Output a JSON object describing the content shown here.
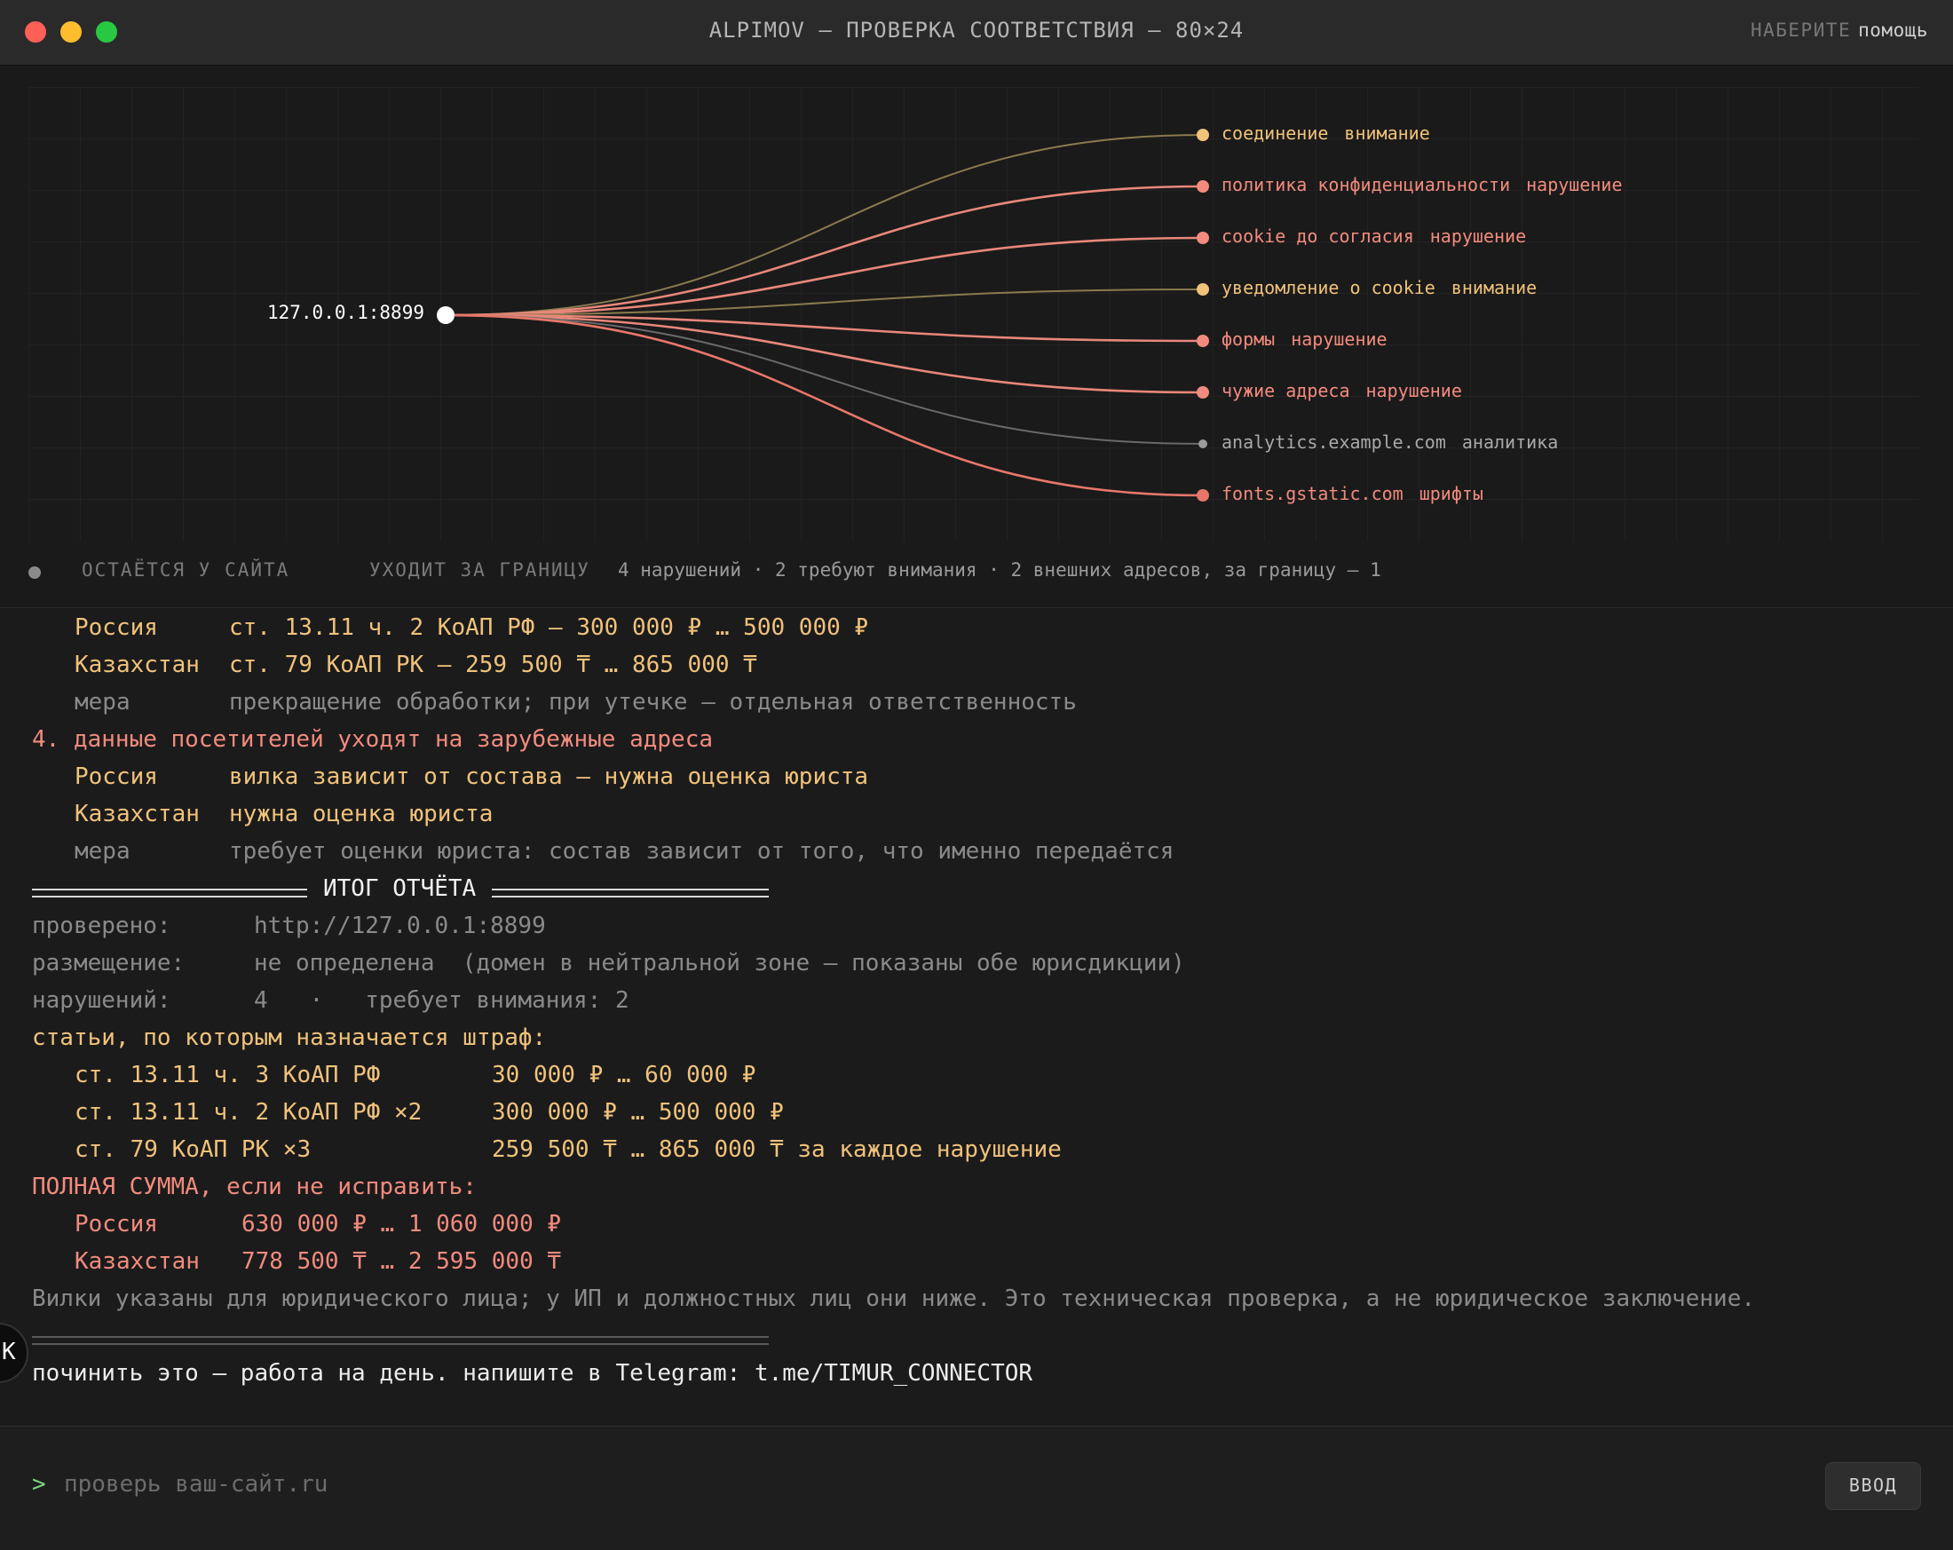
{
  "window": {
    "title": "ALPIMOV — ПРОВЕРКА СООТВЕТСТВИЯ — 80×24",
    "hint_prefix": "НАБЕРИТЕ",
    "hint_action": "помощь"
  },
  "graph": {
    "origin": "127.0.0.1:8899",
    "nodes": [
      {
        "name": "соединение",
        "status": "внимание",
        "level": "warn"
      },
      {
        "name": "политика конфиденциальности",
        "status": "нарушение",
        "level": "violation"
      },
      {
        "name": "cookie до согласия",
        "status": "нарушение",
        "level": "violation"
      },
      {
        "name": "уведомление о cookie",
        "status": "внимание",
        "level": "warn"
      },
      {
        "name": "формы",
        "status": "нарушение",
        "level": "violation"
      },
      {
        "name": "чужие адреса",
        "status": "нарушение",
        "level": "violation"
      },
      {
        "name": "analytics.example.com",
        "status": "аналитика",
        "level": "neutral"
      },
      {
        "name": "fonts.gstatic.com",
        "status": "шрифты",
        "level": "external"
      }
    ],
    "legend": {
      "stays": "ОСТАЁТСЯ У САЙТА",
      "leaves": "УХОДИТ ЗА ГРАНИЦУ",
      "summary": "4 нарушений · 2 требуют внимания · 2 внешних адресов, за границу — 1"
    },
    "colors": {
      "warn": "#f0c27a",
      "violation": "#f28b7d",
      "neutral": "#9a9a9a",
      "external": "#e8776a"
    }
  },
  "report": {
    "item3": {
      "russia_label": "Россия",
      "russia_value": "ст. 13.11 ч. 2 КоАП РФ — 300 000 ₽ … 500 000 ₽",
      "kz_label": "Казахстан",
      "kz_value": "ст. 79 КоАП РК — 259 500 ₸ … 865 000 ₸",
      "measure_label": "мера",
      "measure_value": "прекращение обработки; при утечке — отдельная ответственность"
    },
    "item4": {
      "title": "4. данные посетителей уходят на зарубежные адреса",
      "russia_label": "Россия",
      "russia_value": "вилка зависит от состава — нужна оценка юриста",
      "kz_label": "Казахстан",
      "kz_value": "нужна оценка юриста",
      "measure_label": "мера",
      "measure_value": "требует оценки юриста: состав зависит от того, что именно передаётся"
    },
    "summary_title": "ИТОГ ОТЧЁТА",
    "checked_label": "проверено:",
    "checked_value": "http://127.0.0.1:8899",
    "placement_label": "размещение:",
    "placement_value": "не определена  (домен в нейтральной зоне — показаны обе юрисдикции)",
    "violations_label": "нарушений:",
    "violations_value": "4   ·   требует внимания: 2",
    "articles_title": "статьи, по которым назначается штраф:",
    "articles": [
      {
        "name": "ст. 13.11 ч. 3 КоАП РФ",
        "value": "30 000 ₽ … 60 000 ₽"
      },
      {
        "name": "ст. 13.11 ч. 2 КоАП РФ ×2",
        "value": "300 000 ₽ … 500 000 ₽"
      },
      {
        "name": "ст. 79 КоАП РК ×3",
        "value": "259 500 ₸ … 865 000 ₸ за каждое нарушение"
      }
    ],
    "total_title": "ПОЛНАЯ СУММА, если не исправить:",
    "totals": [
      {
        "name": "Россия",
        "value": "630 000 ₽ … 1 060 000 ₽"
      },
      {
        "name": "Казахстан",
        "value": "778 500 ₸ … 2 595 000 ₸"
      }
    ],
    "disclaimer": "Вилки указаны для юридического лица; у ИП и должностных лиц они ниже. Это техническая проверка, а не юридическое заключение.",
    "cta": "починить это — работа на день. напишите в Telegram: t.me/TIMUR_CONNECTOR"
  },
  "input": {
    "prompt": ">",
    "placeholder": "проверь ваш-сайт.ru",
    "enter_label": "ВВОД"
  }
}
